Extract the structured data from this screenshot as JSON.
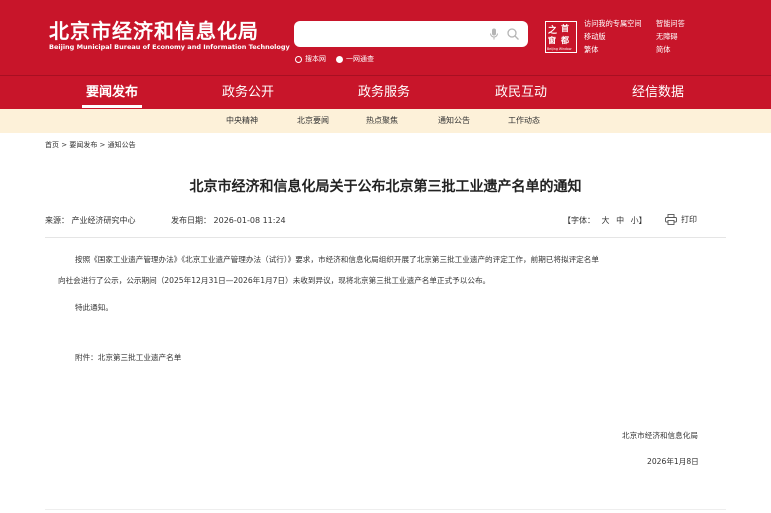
{
  "colors": {
    "brand_red": "#c8152a",
    "subnav_bg": "#fdf1d9",
    "text": "#333333"
  },
  "header": {
    "logo_cn": "北京市经济和信息化局",
    "logo_en": "Beijing Municipal Bureau of Economy and Information Technology",
    "search": {
      "placeholder": "",
      "mic_icon": "mic-icon",
      "search_icon": "search-icon"
    },
    "scope_options": [
      {
        "label": "搜本网",
        "checked": false
      },
      {
        "label": "一网通查",
        "checked": true
      }
    ],
    "badge": {
      "c1": "之",
      "c2": "首",
      "c3": "窗",
      "c4": "都",
      "en": "Beijing Window"
    },
    "links": [
      "访问我的专属空间",
      "智能问答",
      "移动版",
      "无障碍",
      "繁体",
      "简体"
    ]
  },
  "nav": {
    "items": [
      "要闻发布",
      "政务公开",
      "政务服务",
      "政民互动",
      "经信数据"
    ],
    "active": "要闻发布"
  },
  "subnav": {
    "items": [
      "中央精神",
      "北京要闻",
      "热点聚焦",
      "通知公告",
      "工作动态"
    ]
  },
  "breadcrumb": "首页 > 要闻发布 > 通知公告",
  "article": {
    "title": "北京市经济和信息化局关于公布北京第三批工业遗产名单的通知",
    "source": "来源：  产业经济研究中心",
    "publish_date": "发布日期：  2026-01-08 11:24",
    "font_label": "【字体：",
    "font_large": "大",
    "font_medium": "中",
    "font_small": "小】",
    "print_label": "打印",
    "body_line1": "按照《国家工业遗产管理办法》《北京工业遗产管理办法（试行）》要求，市经济和信息化局组织开展了北京第三批工业遗产的评定工作，前期已将拟评定名单",
    "body_line2": "向社会进行了公示，公示期间（2025年12月31日—2026年1月7日）未收到异议，现将北京第三批工业遗产名单正式予以公布。",
    "special_notice": "特此通知。",
    "attachment": "附件：北京第三批工业遗产名单",
    "signature": "北京市经济和信息化局",
    "sign_date": "2026年1月8日"
  }
}
